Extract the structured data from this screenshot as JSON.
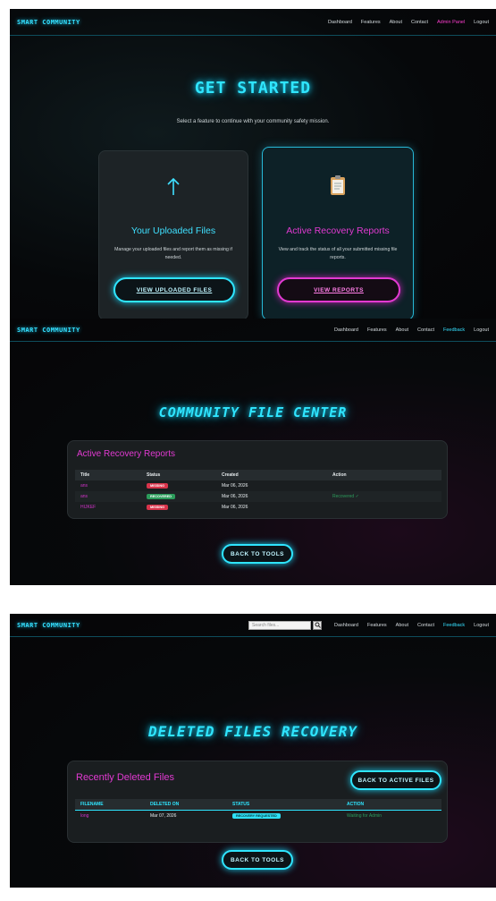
{
  "screen1": {
    "nav": {
      "brand": "SMART COMMUNITY",
      "links": [
        "Dashboard",
        "Features",
        "About",
        "Contact",
        "Admin Panel",
        "Logout"
      ]
    },
    "title": "GET STARTED",
    "subtitle": "Select a feature to continue with your community safety mission.",
    "card1": {
      "icon": "up-arrow-icon",
      "heading": "Your Uploaded Files",
      "description": "Manage your uploaded files and report them as missing if needed.",
      "button": "VIEW UPLOADED FILES"
    },
    "card2": {
      "icon": "clipboard-icon",
      "heading": "Active Recovery Reports",
      "description": "View and track the status of all your submitted missing file reports.",
      "button": "VIEW REPORTS"
    }
  },
  "screen2": {
    "nav": {
      "brand": "SMART COMMUNITY",
      "links": [
        "Dashboard",
        "Features",
        "About",
        "Contact",
        "Feedback",
        "Logout"
      ]
    },
    "title": "COMMUNITY FILE CENTER",
    "panel_title": "Active Recovery Reports",
    "columns": [
      "Title",
      "Status",
      "Created",
      "Action"
    ],
    "rows": [
      {
        "title": "ans",
        "status": "MISSING",
        "created": "Mar 06, 2026",
        "action": ""
      },
      {
        "title": "ans",
        "status": "RECOVERED",
        "created": "Mar 06, 2026",
        "action": "Recovered ✓"
      },
      {
        "title": "HIJKEF",
        "status": "MISSING",
        "created": "Mar 06, 2026",
        "action": ""
      }
    ],
    "button": "BACK TO TOOLS"
  },
  "screen3": {
    "nav": {
      "brand": "SMART COMMUNITY",
      "search_placeholder": "Search files...",
      "links": [
        "Dashboard",
        "Features",
        "About",
        "Contact",
        "Feedback",
        "Logout"
      ]
    },
    "title": "DELETED FILES RECOVERY",
    "panel_title": "Recently Deleted Files",
    "back_active": "BACK TO ACTIVE FILES",
    "columns": [
      "FILENAME",
      "DELETED ON",
      "STATUS",
      "ACTION"
    ],
    "rows": [
      {
        "filename": "long",
        "deleted_on": "Mar 07, 2026",
        "status": "RECOVERY REQUESTED",
        "action": "Waiting for Admin"
      }
    ],
    "button": "BACK TO TOOLS"
  }
}
